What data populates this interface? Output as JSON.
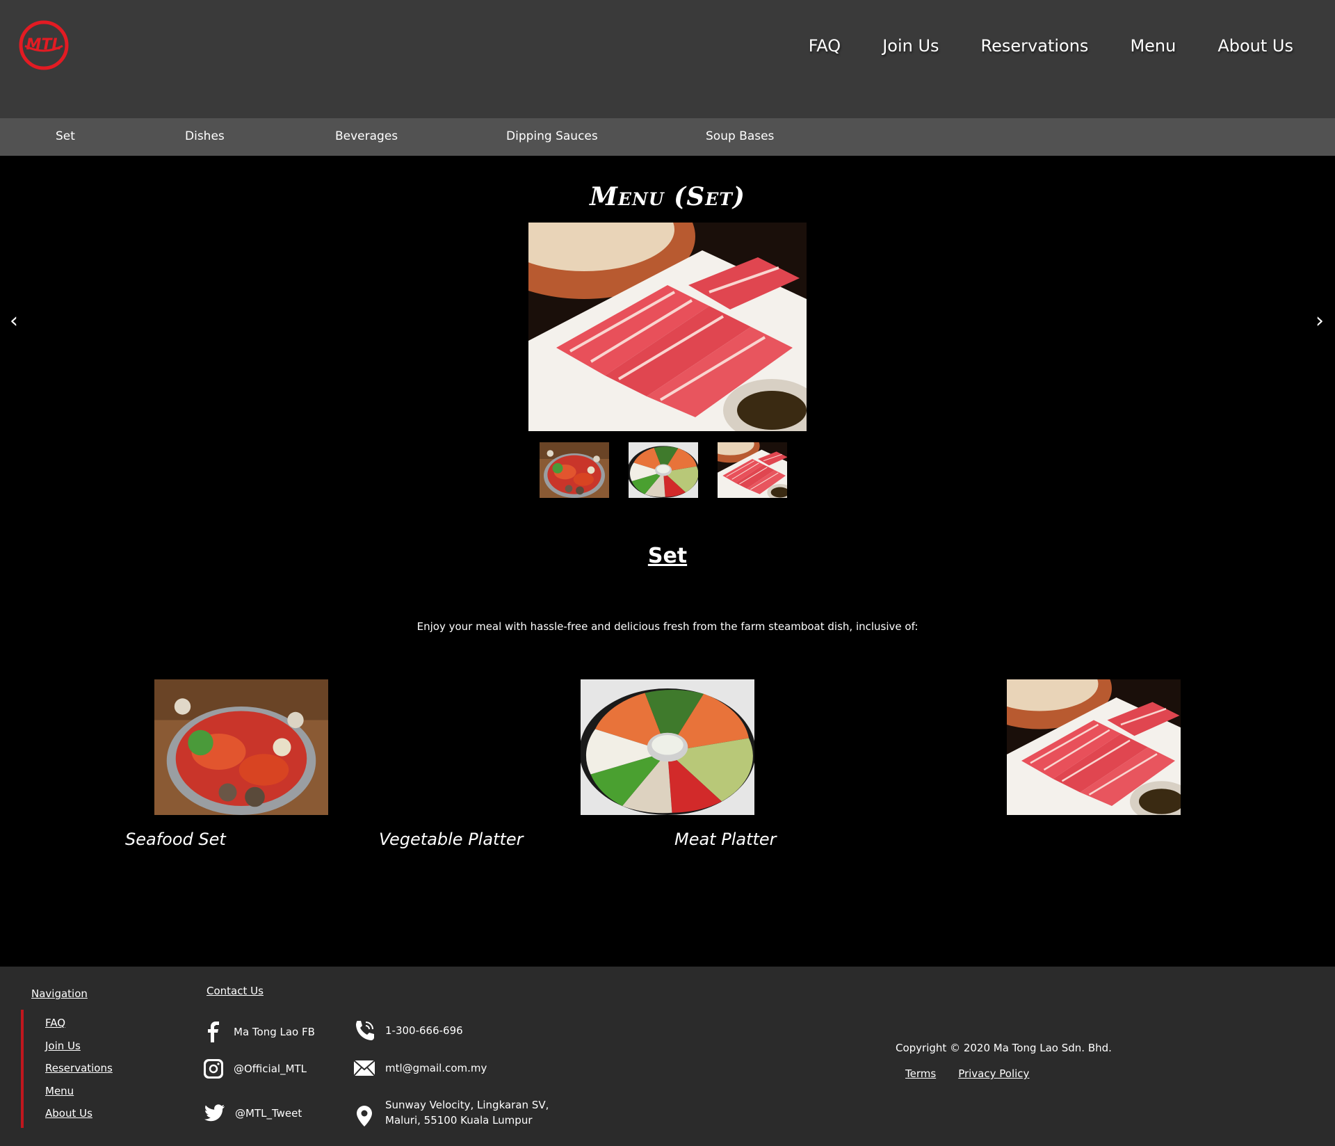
{
  "brand": {
    "logo_text": "MTL",
    "accent_color": "#e31b23"
  },
  "header": {
    "nav": [
      "FAQ",
      "Join Us",
      "Reservations",
      "Menu",
      "About Us"
    ]
  },
  "subnav": {
    "items": [
      "Set",
      "Dishes",
      "Beverages",
      "Dipping Sauces",
      "Soup Bases"
    ]
  },
  "main": {
    "page_title": "Menu (Set)",
    "prev_arrow": "‹",
    "next_arrow": "›",
    "section_title": "Set",
    "intro": "Enjoy your meal with hassle-free and delicious fresh from the farm steamboat dish, inclusive of:",
    "sets": [
      "Seafood Set",
      "Vegetable Platter",
      "Meat Platter"
    ]
  },
  "footer": {
    "nav_title": "Navigation",
    "nav_links": [
      "FAQ",
      "Join Us",
      "Reservations",
      "Menu",
      "About Us"
    ],
    "contact_title": "Contact Us",
    "facebook": "Ma Tong Lao FB",
    "instagram": "@Official_MTL",
    "twitter": "@MTL_Tweet",
    "phone": "1-300-666-696",
    "email": "mtl@gmail.com.my",
    "address_line1": "Sunway Velocity, Lingkaran SV,",
    "address_line2": "Maluri, 55100 Kuala Lumpur",
    "copyright": "Copyright © 2020 Ma Tong Lao Sdn. Bhd.",
    "terms": "Terms",
    "privacy": "Privacy Policy"
  }
}
